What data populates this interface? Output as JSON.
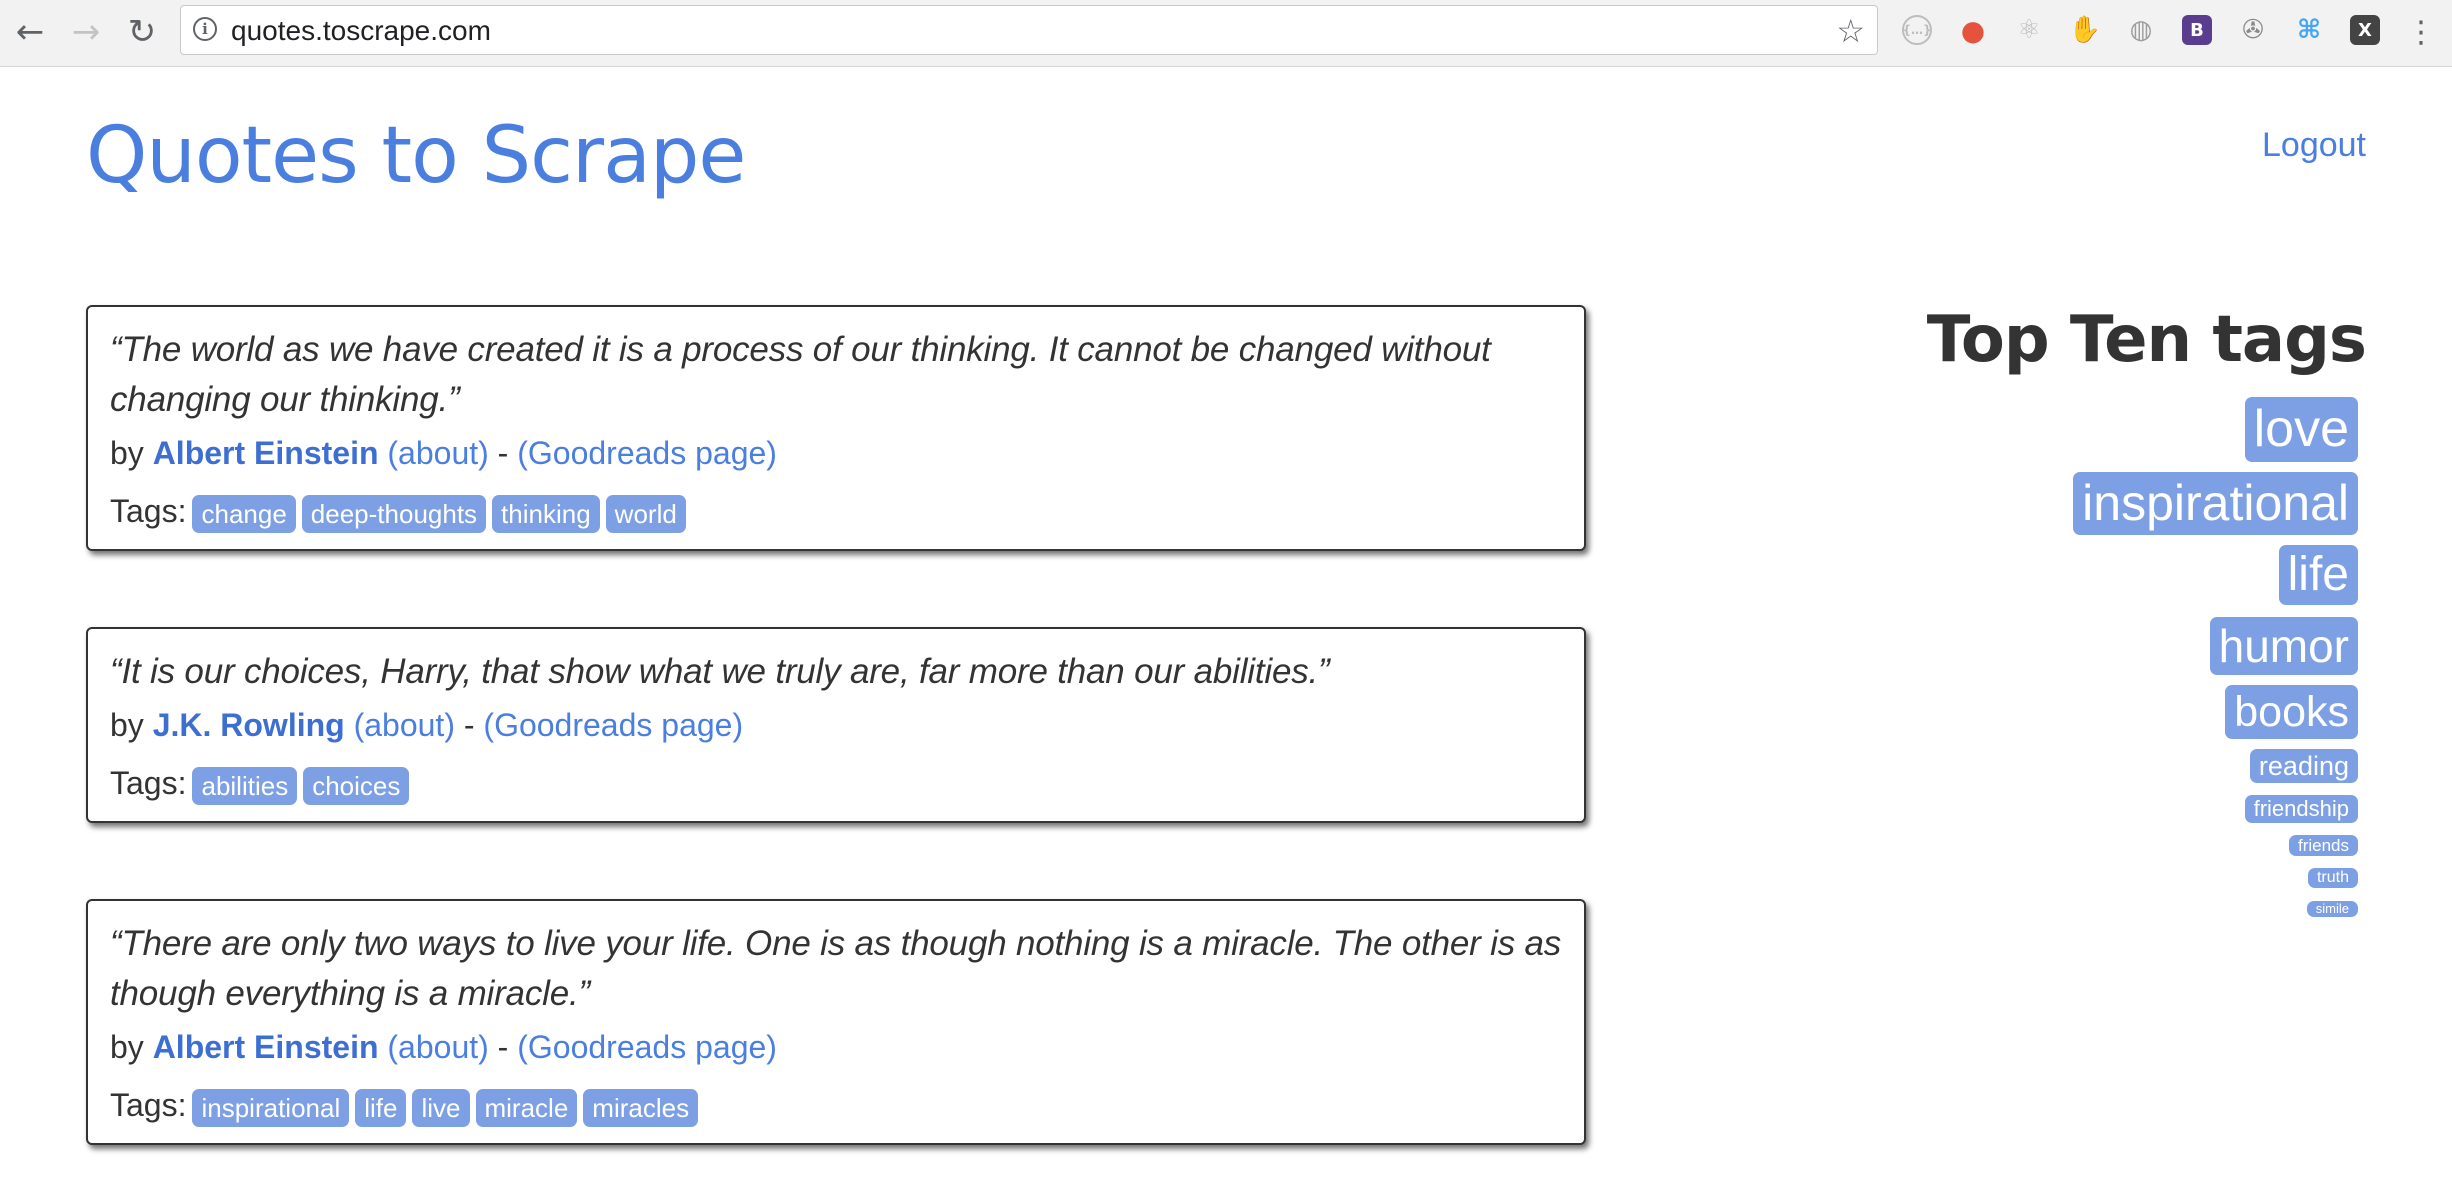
{
  "browser": {
    "url": "quotes.toscrape.com",
    "nav": {
      "back_icon": "←",
      "forward_icon": "→",
      "reload_icon": "↻"
    },
    "star_icon": "☆",
    "menu_icon": "⋮",
    "extensions": [
      {
        "name": "json-viewer-icon",
        "glyph": "{…}",
        "color": "#bdbdbd"
      },
      {
        "name": "postman-icon",
        "glyph": "●",
        "color": "#e5533c"
      },
      {
        "name": "react-devtools-icon",
        "glyph": "⚛",
        "color": "#bdbdbd"
      },
      {
        "name": "adblock-icon",
        "glyph": "✋",
        "color": "#e53935"
      },
      {
        "name": "globe-icon",
        "glyph": "◍",
        "color": "#9e9e9e"
      },
      {
        "name": "bootstrap-icon",
        "glyph": "B",
        "color": "#5b3d8f"
      },
      {
        "name": "film-reel-icon",
        "glyph": "✇",
        "color": "#8a8a8a"
      },
      {
        "name": "command-icon",
        "glyph": "⌘",
        "color": "#42a5f5"
      },
      {
        "name": "x-extension-icon",
        "glyph": "X",
        "color": "#444444"
      }
    ]
  },
  "header": {
    "title": "Quotes to Scrape",
    "logout": "Logout"
  },
  "quotes": [
    {
      "text": "“The world as we have created it is a process of our thinking. It cannot be changed without changing our thinking.”",
      "by": "by",
      "author": "Albert Einstein",
      "about": "(about)",
      "dash": "-",
      "goodreads": "(Goodreads page)",
      "tags_label": "Tags:",
      "tags": [
        "change",
        "deep-thoughts",
        "thinking",
        "world"
      ]
    },
    {
      "text": "“It is our choices, Harry, that show what we truly are, far more than our abilities.”",
      "by": "by",
      "author": "J.K. Rowling",
      "about": "(about)",
      "dash": "-",
      "goodreads": "(Goodreads page)",
      "tags_label": "Tags:",
      "tags": [
        "abilities",
        "choices"
      ]
    },
    {
      "text": "“There are only two ways to live your life. One is as though nothing is a miracle. The other is as though everything is a miracle.”",
      "by": "by",
      "author": "Albert Einstein",
      "about": "(about)",
      "dash": "-",
      "goodreads": "(Goodreads page)",
      "tags_label": "Tags:",
      "tags": [
        "inspirational",
        "life",
        "live",
        "miracle",
        "miracles"
      ]
    }
  ],
  "top_tags": {
    "heading": "Top Ten tags",
    "items": [
      {
        "label": "love",
        "size": 52
      },
      {
        "label": "inspirational",
        "size": 50
      },
      {
        "label": "life",
        "size": 48
      },
      {
        "label": "humor",
        "size": 46
      },
      {
        "label": "books",
        "size": 43
      },
      {
        "label": "reading",
        "size": 27
      },
      {
        "label": "friendship",
        "size": 22
      },
      {
        "label": "friends",
        "size": 17
      },
      {
        "label": "truth",
        "size": 16
      },
      {
        "label": "simile",
        "size": 13
      }
    ]
  }
}
